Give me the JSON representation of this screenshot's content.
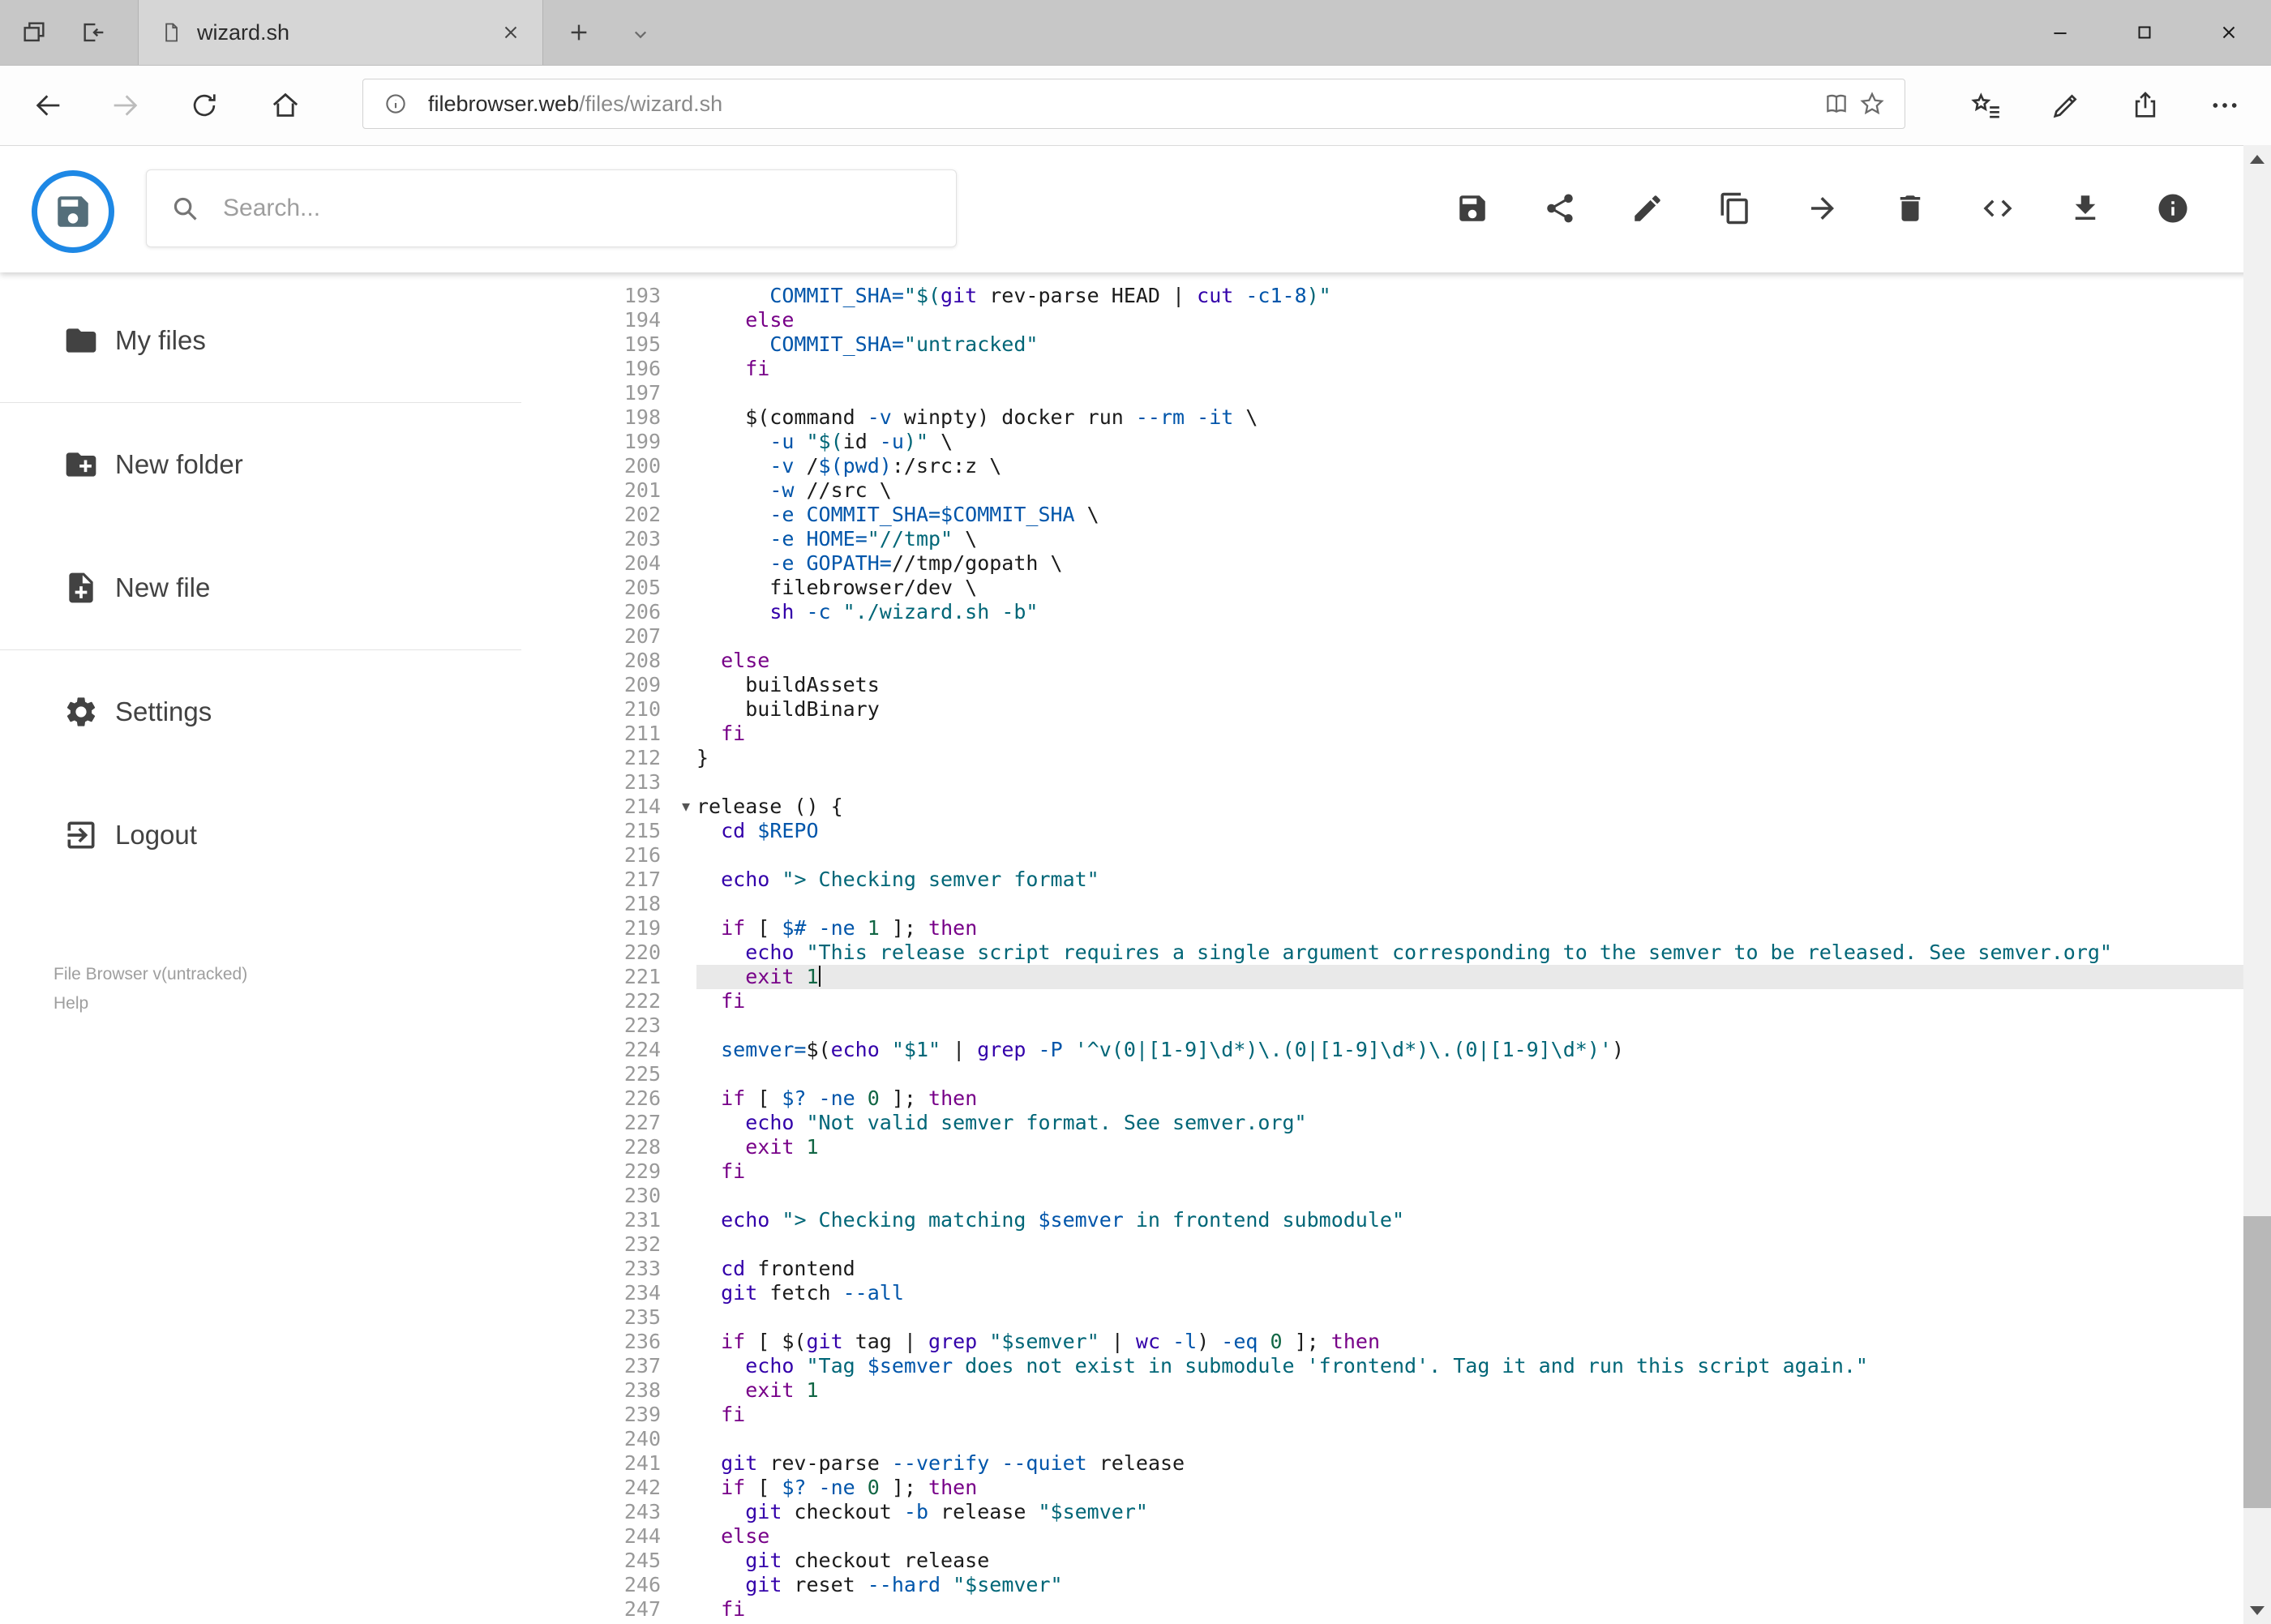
{
  "palette": {
    "accent": "#1e88e5",
    "tok-p": "#1b1b1b",
    "tok-k": "#770088",
    "tok-b": "#3300aa",
    "tok-s": "#006677",
    "tok-a": "#0055aa",
    "tok-n": "#116644",
    "gutter": "#999999",
    "activeline": "#e9e9e9"
  },
  "browser": {
    "tab": {
      "title": "wizard.sh"
    },
    "address": {
      "host": "filebrowser.web",
      "path": "/files/wizard.sh"
    }
  },
  "toolbar": {
    "search_placeholder": "Search...",
    "buttons": [
      "save",
      "share",
      "edit",
      "copy",
      "move",
      "delete",
      "code",
      "download",
      "info"
    ]
  },
  "sidebar": {
    "items": [
      {
        "label": "My files",
        "icon": "folder"
      },
      {
        "label": "New folder",
        "icon": "new-folder"
      },
      {
        "label": "New file",
        "icon": "new-file"
      },
      {
        "label": "Settings",
        "icon": "settings"
      },
      {
        "label": "Logout",
        "icon": "logout"
      }
    ],
    "footer": {
      "version": "File Browser v(untracked)",
      "help": "Help"
    }
  },
  "editor": {
    "active_line": 221,
    "fold_line": 214,
    "lines": [
      {
        "n": 193,
        "seg": [
          [
            "p",
            "      "
          ],
          [
            "a",
            "COMMIT_SHA="
          ],
          [
            "s",
            "\"$("
          ],
          [
            "b",
            "git"
          ],
          [
            "p",
            " rev-parse HEAD | "
          ],
          [
            "b",
            "cut"
          ],
          [
            "p",
            " "
          ],
          [
            "a",
            "-c1-8"
          ],
          [
            "s",
            ")\""
          ]
        ]
      },
      {
        "n": 194,
        "seg": [
          [
            "p",
            "    "
          ],
          [
            "k",
            "else"
          ]
        ]
      },
      {
        "n": 195,
        "seg": [
          [
            "p",
            "      "
          ],
          [
            "a",
            "COMMIT_SHA="
          ],
          [
            "s",
            "\"untracked\""
          ]
        ]
      },
      {
        "n": 196,
        "seg": [
          [
            "p",
            "    "
          ],
          [
            "k",
            "fi"
          ]
        ]
      },
      {
        "n": 197,
        "seg": []
      },
      {
        "n": 198,
        "seg": [
          [
            "p",
            "    $(command "
          ],
          [
            "a",
            "-v"
          ],
          [
            "p",
            " winpty) docker run "
          ],
          [
            "a",
            "--rm"
          ],
          [
            "p",
            " "
          ],
          [
            "a",
            "-it"
          ],
          [
            "p",
            " \\"
          ]
        ]
      },
      {
        "n": 199,
        "seg": [
          [
            "p",
            "      "
          ],
          [
            "a",
            "-u"
          ],
          [
            "p",
            " "
          ],
          [
            "s",
            "\"$("
          ],
          [
            "p",
            "id "
          ],
          [
            "a",
            "-u"
          ],
          [
            "s",
            ")\""
          ],
          [
            "p",
            " \\"
          ]
        ]
      },
      {
        "n": 200,
        "seg": [
          [
            "p",
            "      "
          ],
          [
            "a",
            "-v"
          ],
          [
            "p",
            " /"
          ],
          [
            "a",
            "$(pwd)"
          ],
          [
            "p",
            ":/src:z \\"
          ]
        ]
      },
      {
        "n": 201,
        "seg": [
          [
            "p",
            "      "
          ],
          [
            "a",
            "-w"
          ],
          [
            "p",
            " //src \\"
          ]
        ]
      },
      {
        "n": 202,
        "seg": [
          [
            "p",
            "      "
          ],
          [
            "a",
            "-e"
          ],
          [
            "p",
            " "
          ],
          [
            "a",
            "COMMIT_SHA=$COMMIT_SHA"
          ],
          [
            "p",
            " \\"
          ]
        ]
      },
      {
        "n": 203,
        "seg": [
          [
            "p",
            "      "
          ],
          [
            "a",
            "-e"
          ],
          [
            "p",
            " "
          ],
          [
            "a",
            "HOME="
          ],
          [
            "s",
            "\"//tmp\""
          ],
          [
            "p",
            " \\"
          ]
        ]
      },
      {
        "n": 204,
        "seg": [
          [
            "p",
            "      "
          ],
          [
            "a",
            "-e"
          ],
          [
            "p",
            " "
          ],
          [
            "a",
            "GOPATH="
          ],
          [
            "p",
            "//tmp/gopath \\"
          ]
        ]
      },
      {
        "n": 205,
        "seg": [
          [
            "p",
            "      filebrowser/dev \\"
          ]
        ]
      },
      {
        "n": 206,
        "seg": [
          [
            "p",
            "      "
          ],
          [
            "b",
            "sh"
          ],
          [
            "p",
            " "
          ],
          [
            "a",
            "-c"
          ],
          [
            "p",
            " "
          ],
          [
            "s",
            "\"./wizard.sh -b\""
          ]
        ]
      },
      {
        "n": 207,
        "seg": []
      },
      {
        "n": 208,
        "seg": [
          [
            "p",
            "  "
          ],
          [
            "k",
            "else"
          ]
        ]
      },
      {
        "n": 209,
        "seg": [
          [
            "p",
            "    buildAssets"
          ]
        ]
      },
      {
        "n": 210,
        "seg": [
          [
            "p",
            "    buildBinary"
          ]
        ]
      },
      {
        "n": 211,
        "seg": [
          [
            "p",
            "  "
          ],
          [
            "k",
            "fi"
          ]
        ]
      },
      {
        "n": 212,
        "seg": [
          [
            "p",
            "}"
          ]
        ]
      },
      {
        "n": 213,
        "seg": []
      },
      {
        "n": 214,
        "seg": [
          [
            "p",
            "release () {"
          ]
        ]
      },
      {
        "n": 215,
        "seg": [
          [
            "p",
            "  "
          ],
          [
            "b",
            "cd"
          ],
          [
            "p",
            " "
          ],
          [
            "a",
            "$REPO"
          ]
        ]
      },
      {
        "n": 216,
        "seg": []
      },
      {
        "n": 217,
        "seg": [
          [
            "p",
            "  "
          ],
          [
            "b",
            "echo"
          ],
          [
            "p",
            " "
          ],
          [
            "s",
            "\"> Checking semver format\""
          ]
        ]
      },
      {
        "n": 218,
        "seg": []
      },
      {
        "n": 219,
        "seg": [
          [
            "p",
            "  "
          ],
          [
            "k",
            "if"
          ],
          [
            "p",
            " [ "
          ],
          [
            "a",
            "$#"
          ],
          [
            "p",
            " "
          ],
          [
            "a",
            "-ne"
          ],
          [
            "p",
            " "
          ],
          [
            "n",
            "1"
          ],
          [
            "p",
            " ]; "
          ],
          [
            "k",
            "then"
          ]
        ]
      },
      {
        "n": 220,
        "seg": [
          [
            "p",
            "    "
          ],
          [
            "b",
            "echo"
          ],
          [
            "p",
            " "
          ],
          [
            "s",
            "\"This release script requires a single argument corresponding to the semver to be released. See semver.org\""
          ]
        ]
      },
      {
        "n": 221,
        "seg": [
          [
            "p",
            "    "
          ],
          [
            "k",
            "exit"
          ],
          [
            "p",
            " "
          ],
          [
            "n",
            "1"
          ]
        ]
      },
      {
        "n": 222,
        "seg": [
          [
            "p",
            "  "
          ],
          [
            "k",
            "fi"
          ]
        ]
      },
      {
        "n": 223,
        "seg": []
      },
      {
        "n": 224,
        "seg": [
          [
            "p",
            "  "
          ],
          [
            "a",
            "semver="
          ],
          [
            "p",
            "$("
          ],
          [
            "b",
            "echo"
          ],
          [
            "p",
            " "
          ],
          [
            "s",
            "\"$1\""
          ],
          [
            "p",
            " | "
          ],
          [
            "b",
            "grep"
          ],
          [
            "p",
            " "
          ],
          [
            "a",
            "-P"
          ],
          [
            "p",
            " "
          ],
          [
            "s",
            "'^v(0|[1-9]\\d*)\\.(0|[1-9]\\d*)\\.(0|[1-9]\\d*)'"
          ],
          [
            "p",
            ")"
          ]
        ]
      },
      {
        "n": 225,
        "seg": []
      },
      {
        "n": 226,
        "seg": [
          [
            "p",
            "  "
          ],
          [
            "k",
            "if"
          ],
          [
            "p",
            " [ "
          ],
          [
            "a",
            "$?"
          ],
          [
            "p",
            " "
          ],
          [
            "a",
            "-ne"
          ],
          [
            "p",
            " "
          ],
          [
            "n",
            "0"
          ],
          [
            "p",
            " ]; "
          ],
          [
            "k",
            "then"
          ]
        ]
      },
      {
        "n": 227,
        "seg": [
          [
            "p",
            "    "
          ],
          [
            "b",
            "echo"
          ],
          [
            "p",
            " "
          ],
          [
            "s",
            "\"Not valid semver format. See semver.org\""
          ]
        ]
      },
      {
        "n": 228,
        "seg": [
          [
            "p",
            "    "
          ],
          [
            "k",
            "exit"
          ],
          [
            "p",
            " "
          ],
          [
            "n",
            "1"
          ]
        ]
      },
      {
        "n": 229,
        "seg": [
          [
            "p",
            "  "
          ],
          [
            "k",
            "fi"
          ]
        ]
      },
      {
        "n": 230,
        "seg": []
      },
      {
        "n": 231,
        "seg": [
          [
            "p",
            "  "
          ],
          [
            "b",
            "echo"
          ],
          [
            "p",
            " "
          ],
          [
            "s",
            "\"> Checking matching "
          ],
          [
            "a",
            "$semver"
          ],
          [
            "s",
            " in frontend submodule\""
          ]
        ]
      },
      {
        "n": 232,
        "seg": []
      },
      {
        "n": 233,
        "seg": [
          [
            "p",
            "  "
          ],
          [
            "b",
            "cd"
          ],
          [
            "p",
            " frontend"
          ]
        ]
      },
      {
        "n": 234,
        "seg": [
          [
            "p",
            "  "
          ],
          [
            "b",
            "git"
          ],
          [
            "p",
            " fetch "
          ],
          [
            "a",
            "--all"
          ]
        ]
      },
      {
        "n": 235,
        "seg": []
      },
      {
        "n": 236,
        "seg": [
          [
            "p",
            "  "
          ],
          [
            "k",
            "if"
          ],
          [
            "p",
            " [ $("
          ],
          [
            "b",
            "git"
          ],
          [
            "p",
            " tag | "
          ],
          [
            "b",
            "grep"
          ],
          [
            "p",
            " "
          ],
          [
            "s",
            "\"$semver\""
          ],
          [
            "p",
            " | "
          ],
          [
            "b",
            "wc"
          ],
          [
            "p",
            " "
          ],
          [
            "a",
            "-l"
          ],
          [
            "p",
            ") "
          ],
          [
            "a",
            "-eq"
          ],
          [
            "p",
            " "
          ],
          [
            "n",
            "0"
          ],
          [
            "p",
            " ]; "
          ],
          [
            "k",
            "then"
          ]
        ]
      },
      {
        "n": 237,
        "seg": [
          [
            "p",
            "    "
          ],
          [
            "b",
            "echo"
          ],
          [
            "p",
            " "
          ],
          [
            "s",
            "\"Tag "
          ],
          [
            "a",
            "$semver"
          ],
          [
            "s",
            " does not exist in submodule 'frontend'. Tag it and run this script again.\""
          ]
        ]
      },
      {
        "n": 238,
        "seg": [
          [
            "p",
            "    "
          ],
          [
            "k",
            "exit"
          ],
          [
            "p",
            " "
          ],
          [
            "n",
            "1"
          ]
        ]
      },
      {
        "n": 239,
        "seg": [
          [
            "p",
            "  "
          ],
          [
            "k",
            "fi"
          ]
        ]
      },
      {
        "n": 240,
        "seg": []
      },
      {
        "n": 241,
        "seg": [
          [
            "p",
            "  "
          ],
          [
            "b",
            "git"
          ],
          [
            "p",
            " rev-parse "
          ],
          [
            "a",
            "--verify"
          ],
          [
            "p",
            " "
          ],
          [
            "a",
            "--quiet"
          ],
          [
            "p",
            " release"
          ]
        ]
      },
      {
        "n": 242,
        "seg": [
          [
            "p",
            "  "
          ],
          [
            "k",
            "if"
          ],
          [
            "p",
            " [ "
          ],
          [
            "a",
            "$?"
          ],
          [
            "p",
            " "
          ],
          [
            "a",
            "-ne"
          ],
          [
            "p",
            " "
          ],
          [
            "n",
            "0"
          ],
          [
            "p",
            " ]; "
          ],
          [
            "k",
            "then"
          ]
        ]
      },
      {
        "n": 243,
        "seg": [
          [
            "p",
            "    "
          ],
          [
            "b",
            "git"
          ],
          [
            "p",
            " checkout "
          ],
          [
            "a",
            "-b"
          ],
          [
            "p",
            " release "
          ],
          [
            "s",
            "\"$semver\""
          ]
        ]
      },
      {
        "n": 244,
        "seg": [
          [
            "p",
            "  "
          ],
          [
            "k",
            "else"
          ]
        ]
      },
      {
        "n": 245,
        "seg": [
          [
            "p",
            "    "
          ],
          [
            "b",
            "git"
          ],
          [
            "p",
            " checkout release"
          ]
        ]
      },
      {
        "n": 246,
        "seg": [
          [
            "p",
            "    "
          ],
          [
            "b",
            "git"
          ],
          [
            "p",
            " reset "
          ],
          [
            "a",
            "--hard"
          ],
          [
            "p",
            " "
          ],
          [
            "s",
            "\"$semver\""
          ]
        ]
      },
      {
        "n": 247,
        "seg": [
          [
            "p",
            "  "
          ],
          [
            "k",
            "fi"
          ]
        ]
      }
    ]
  }
}
